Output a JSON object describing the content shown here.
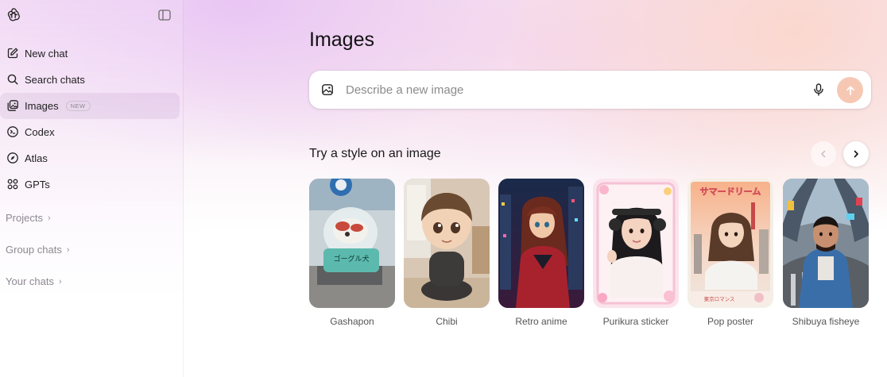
{
  "sidebar": {
    "logo": "openai-logo-icon",
    "toggle": "sidebar-toggle-icon",
    "items": [
      {
        "label": "New chat",
        "icon": "compose-icon"
      },
      {
        "label": "Search chats",
        "icon": "search-icon"
      },
      {
        "label": "Images",
        "icon": "images-icon",
        "badge": "NEW",
        "active": true
      },
      {
        "label": "Codex",
        "icon": "codex-icon"
      },
      {
        "label": "Atlas",
        "icon": "compass-icon"
      },
      {
        "label": "GPTs",
        "icon": "grid-icon"
      }
    ],
    "sections": [
      {
        "label": "Projects"
      },
      {
        "label": "Group chats"
      },
      {
        "label": "Your chats"
      }
    ]
  },
  "main": {
    "title": "Images",
    "prompt": {
      "placeholder": "Describe a new image"
    },
    "styles_title": "Try a style on an image",
    "styles": [
      {
        "label": "Gashapon"
      },
      {
        "label": "Chibi"
      },
      {
        "label": "Retro anime"
      },
      {
        "label": "Purikura sticker"
      },
      {
        "label": "Pop poster"
      },
      {
        "label": "Shibuya fisheye"
      }
    ],
    "thumb_text": {
      "gashapon": "ゴーグル犬",
      "pop_poster_title": "サマードリーム",
      "pop_poster_footer": "東京ロマンス"
    }
  },
  "colors": {
    "send_button": "#f6c8b4",
    "active_item": "#ecdcef",
    "muted_text": "#8e8893"
  }
}
